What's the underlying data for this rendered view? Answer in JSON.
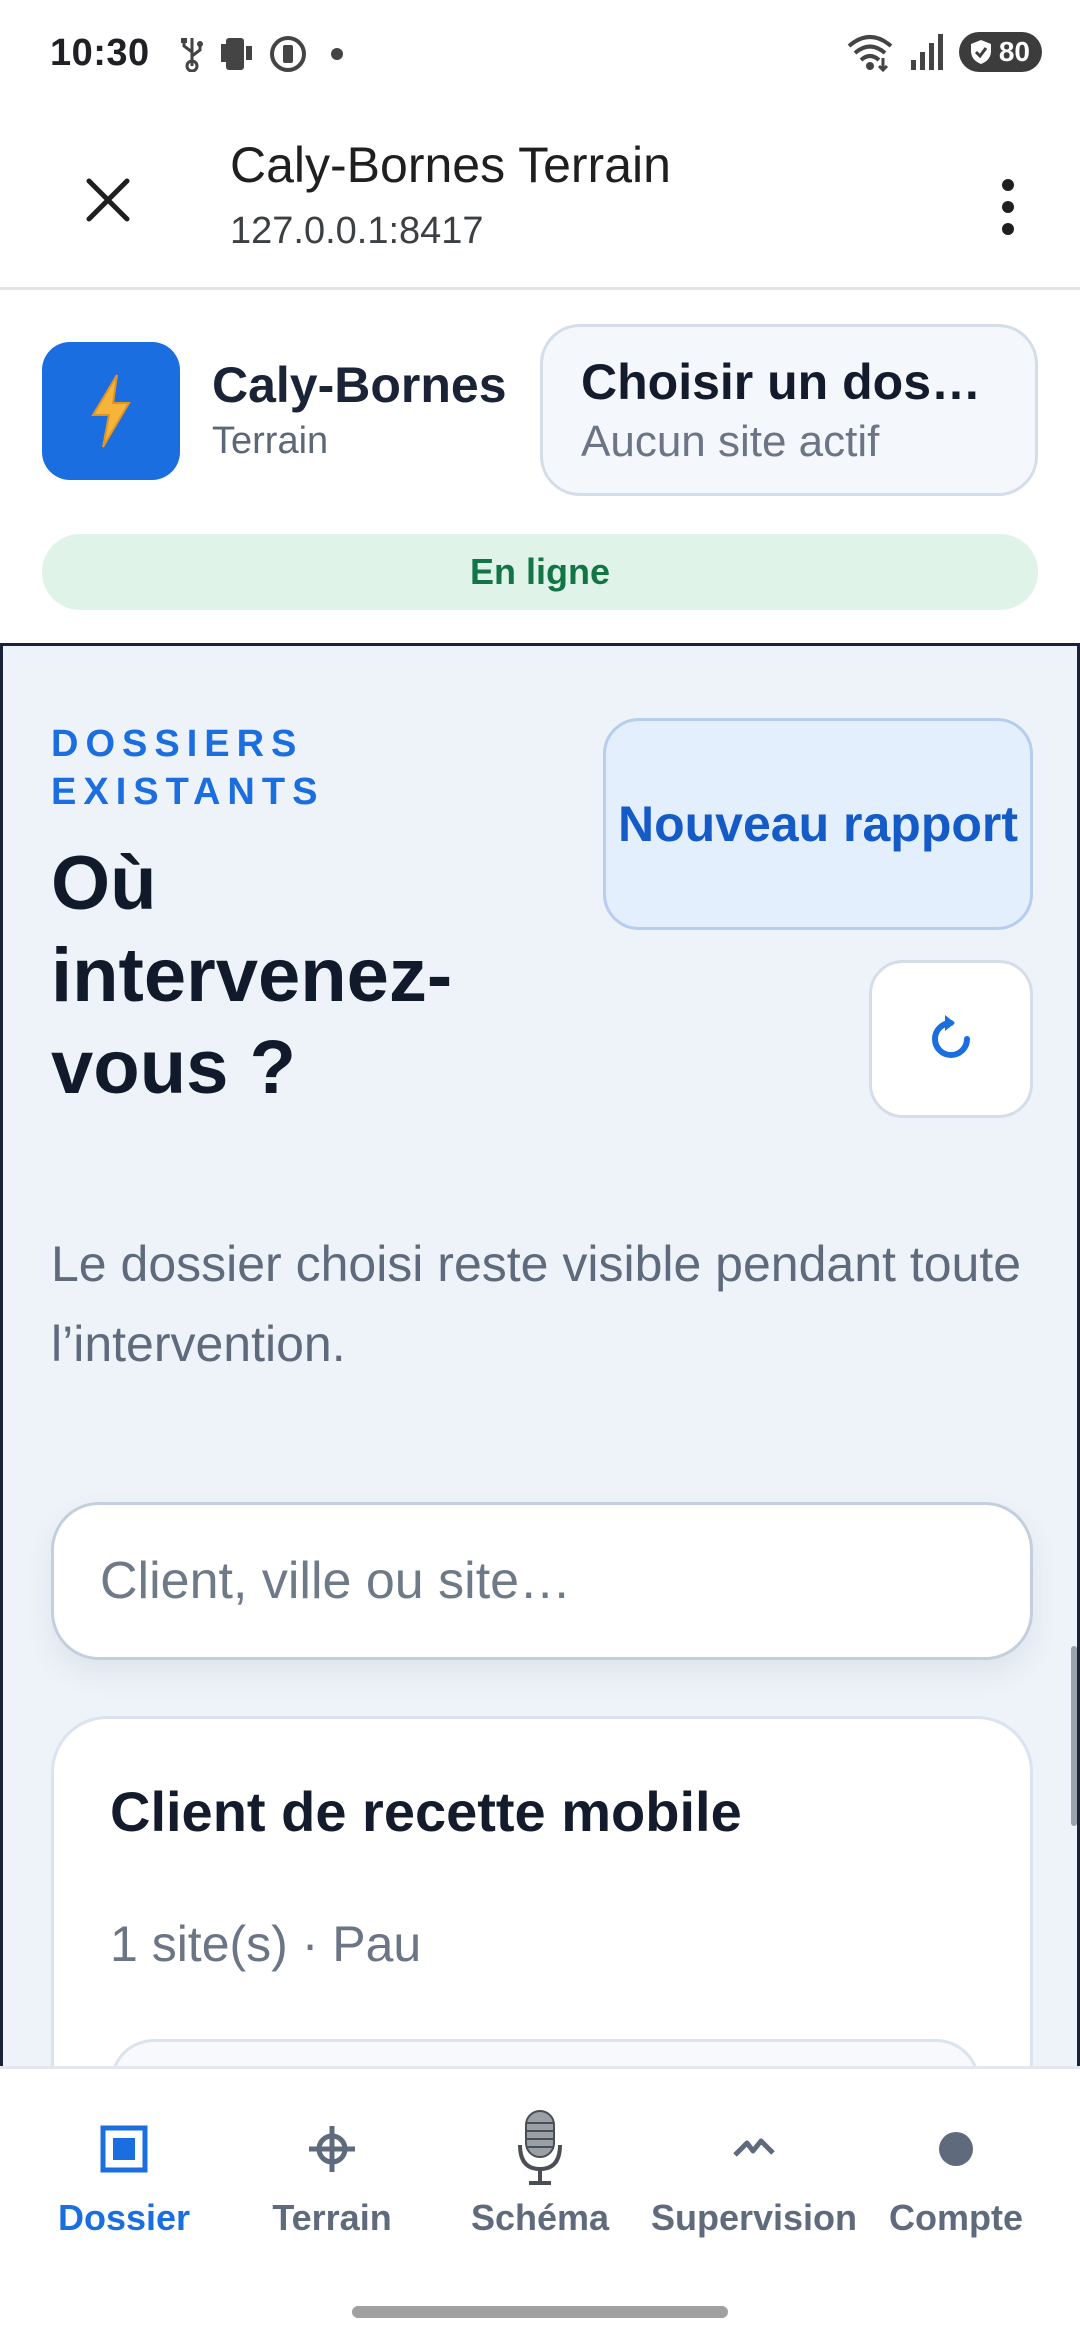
{
  "status_bar": {
    "time": "10:30",
    "battery": "80",
    "icons": [
      "usb-icon",
      "screen-icon",
      "data-saver-icon",
      "dot-icon",
      "wifi-icon",
      "signal-icon",
      "battery-icon"
    ]
  },
  "toolbar": {
    "title": "Caly-Bornes Terrain",
    "url": "127.0.0.1:8417",
    "close_icon": "close-icon",
    "menu_icon": "more-vert-icon"
  },
  "app_header": {
    "app_name": "Caly-Bornes",
    "app_subtitle": "Terrain",
    "logo_icon": "lightning-bolt-icon",
    "dossier_picker": {
      "title": "Choisir un dossier",
      "subtitle": "Aucun site actif"
    },
    "status_pill": "En ligne"
  },
  "main": {
    "eyebrow": "DOSSIERS EXISTANTS",
    "heading": "Où intervenez-vous ?",
    "new_report_label": "Nouveau rapport",
    "refresh_icon": "refresh-icon",
    "description": "Le dossier choisi reste visible pendant toute l’intervention.",
    "search": {
      "placeholder": "Client, ville ou site…",
      "value": ""
    },
    "clients": [
      {
        "name": "Client de recette mobile",
        "meta": "1 site(s) · Pau"
      }
    ]
  },
  "bottom_nav": {
    "items": [
      {
        "label": "Dossier",
        "icon": "square-target-icon",
        "active": true
      },
      {
        "label": "Terrain",
        "icon": "crosshair-icon",
        "active": false
      },
      {
        "label": "Schéma",
        "icon": "microphone-icon",
        "active": false
      },
      {
        "label": "Supervision",
        "icon": "pulse-icon",
        "active": false
      },
      {
        "label": "Compte",
        "icon": "circle-icon",
        "active": false
      }
    ]
  },
  "colors": {
    "accent": "#1a6ee0",
    "online_bg": "#dff3e8",
    "online_text": "#137447",
    "content_bg": "#eef3f9"
  }
}
